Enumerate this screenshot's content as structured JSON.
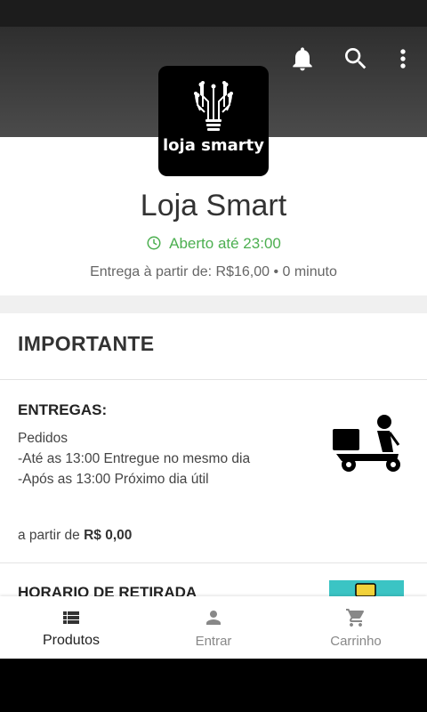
{
  "store": {
    "name": "Loja Smart",
    "logo_text": "loja smarty",
    "status": "Aberto até 23:00",
    "delivery_info": "Entrega à partir de: R$16,00 • 0 minuto"
  },
  "important": {
    "title": "IMPORTANTE"
  },
  "deliveries": {
    "title": "ENTREGAS:",
    "lines": [
      "Pedidos",
      "-Até as 13:00 Entregue no mesmo dia",
      "-Após as 13:00 Próximo dia útil"
    ],
    "price_prefix": "a partir de",
    "price": "R$ 0,00"
  },
  "pickup": {
    "title": "HORARIO DE RETIRADA"
  },
  "nav": {
    "items": [
      {
        "label": "Produtos",
        "icon": "list-icon",
        "active": true
      },
      {
        "label": "Entrar",
        "icon": "person-icon",
        "active": false
      },
      {
        "label": "Carrinho",
        "icon": "cart-icon",
        "active": false
      }
    ]
  },
  "colors": {
    "open_status": "#4caf50",
    "appbar": "#3a3a3a"
  }
}
